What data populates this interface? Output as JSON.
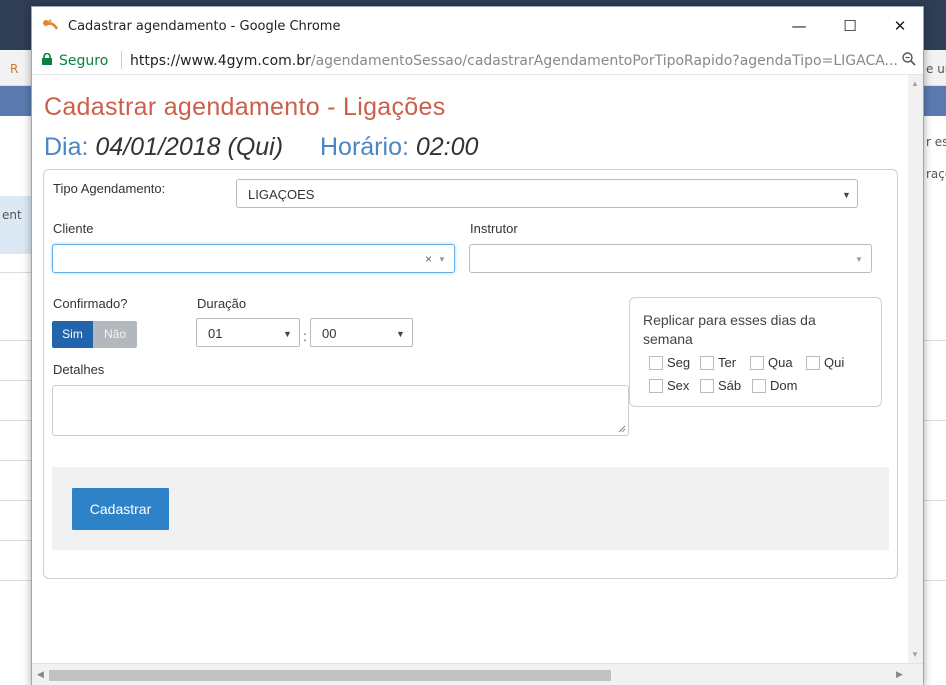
{
  "window": {
    "title": "Cadastrar agendamento - Google Chrome",
    "minimize": "—",
    "maximize": "☐",
    "close": "✕"
  },
  "urlbar": {
    "secure": "Seguro",
    "url_domain": "https://www.4gym.com.br",
    "url_path": "/agendamentoSessao/cadastrarAgendamentoPorTipoRapido?agendaTipo=LIGACA..."
  },
  "background": {
    "left_text_1": "R",
    "left_text_2": "ent",
    "right_text_1": "e ur",
    "right_text_2": "r es",
    "right_text_3": "raçõ"
  },
  "page": {
    "title": "Cadastrar agendamento - Ligações",
    "dia_label": "Dia:",
    "dia_value": "04/01/2018 (Qui)",
    "horario_label": "Horário:",
    "horario_value": "02:00"
  },
  "form": {
    "tipo_label": "Tipo Agendamento:",
    "tipo_value": "LIGAÇOES",
    "cliente_label": "Cliente",
    "cliente_value": "",
    "instrutor_label": "Instrutor",
    "instrutor_value": "",
    "confirmado_label": "Confirmado?",
    "confirmado_sim": "Sim",
    "confirmado_nao": "Não",
    "duracao_label": "Duração",
    "duracao_horas": "01",
    "duracao_sep": ":",
    "duracao_minutos": "00",
    "detalhes_label": "Detalhes",
    "detalhes_value": "",
    "replicar_label": "Replicar para esses dias da semana",
    "days": [
      "Seg",
      "Ter",
      "Qua",
      "Qui",
      "Sex",
      "Sáb",
      "Dom"
    ],
    "submit": "Cadastrar"
  },
  "colors": {
    "title": "#cc5f4b",
    "date_label": "#4a86c5",
    "toggle_on": "#2265ad",
    "toggle_off": "#b2b8bd",
    "button": "#2d82c8",
    "secure": "#0b8043"
  }
}
